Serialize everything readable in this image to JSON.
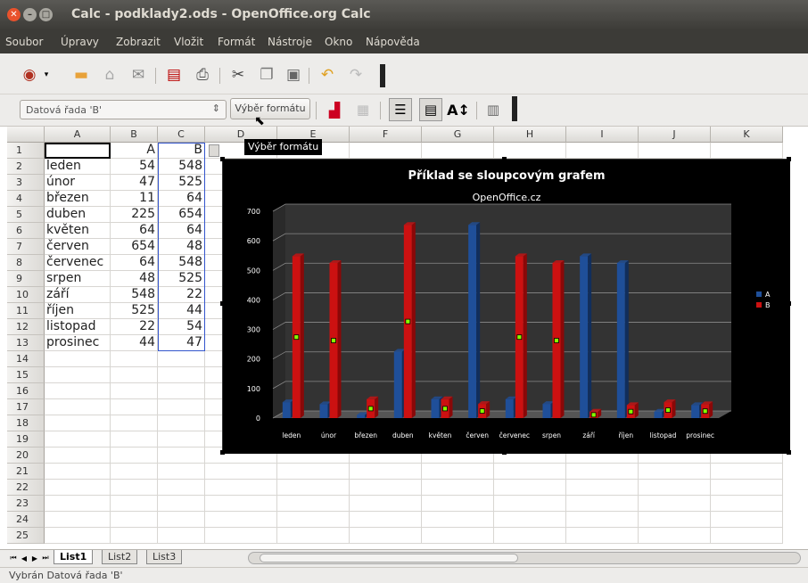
{
  "window": {
    "title": "Calc - podklady2.ods - OpenOffice.org Calc"
  },
  "menu": [
    "Soubor",
    "Úpravy",
    "Zobrazit",
    "Vložit",
    "Formát",
    "Nástroje",
    "Okno",
    "Nápověda"
  ],
  "toolbar2": {
    "combo_value": "Datová řada 'B'",
    "format_button": "Výběr formátu"
  },
  "tooltip": "Výběr formátu",
  "columns": [
    "A",
    "B",
    "C",
    "D",
    "E",
    "F",
    "G",
    "H",
    "I",
    "J",
    "K"
  ],
  "rows": [
    "1",
    "2",
    "3",
    "4",
    "5",
    "6",
    "7",
    "8",
    "9",
    "10",
    "11",
    "12",
    "13",
    "14",
    "15",
    "16",
    "17",
    "18",
    "19",
    "20",
    "21",
    "22",
    "23",
    "24",
    "25"
  ],
  "table": {
    "header": {
      "a": "",
      "b": "A",
      "c": "B"
    },
    "data": [
      {
        "m": "leden",
        "b": "54",
        "c": "548"
      },
      {
        "m": "únor",
        "b": "47",
        "c": "525"
      },
      {
        "m": "březen",
        "b": "11",
        "c": "64"
      },
      {
        "m": "duben",
        "b": "225",
        "c": "654"
      },
      {
        "m": "květen",
        "b": "64",
        "c": "64"
      },
      {
        "m": "červen",
        "b": "654",
        "c": "48"
      },
      {
        "m": "červenec",
        "b": "64",
        "c": "548"
      },
      {
        "m": "srpen",
        "b": "48",
        "c": "525"
      },
      {
        "m": "září",
        "b": "548",
        "c": "22"
      },
      {
        "m": "říjen",
        "b": "525",
        "c": "44"
      },
      {
        "m": "listopad",
        "b": "22",
        "c": "54"
      },
      {
        "m": "prosinec",
        "b": "44",
        "c": "47"
      }
    ]
  },
  "chart_data": {
    "type": "bar",
    "title": "Příklad se sloupcovým grafem",
    "subtitle": "OpenOffice.cz",
    "categories": [
      "leden",
      "únor",
      "březen",
      "duben",
      "květen",
      "červen",
      "červenec",
      "srpen",
      "září",
      "říjen",
      "listopad",
      "prosinec"
    ],
    "series": [
      {
        "name": "A",
        "color": "#1f4f99",
        "values": [
          54,
          47,
          11,
          225,
          64,
          654,
          64,
          48,
          548,
          525,
          22,
          44
        ]
      },
      {
        "name": "B",
        "color": "#cc1111",
        "values": [
          548,
          525,
          64,
          654,
          64,
          48,
          548,
          525,
          22,
          44,
          54,
          47
        ]
      }
    ],
    "ylim": [
      0,
      700
    ],
    "yticks": [
      0,
      100,
      200,
      300,
      400,
      500,
      600,
      700
    ],
    "legend": "right",
    "grid": true,
    "background": "#000000"
  },
  "sheet_tabs": [
    "List1",
    "List2",
    "List3"
  ],
  "status": "Vybrán Datová řada  'B'"
}
